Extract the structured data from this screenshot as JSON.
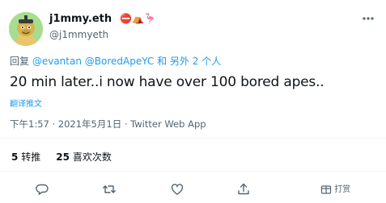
{
  "author": {
    "display_name": "j1mmy.eth",
    "badges": "⛔⛺🦩",
    "handle": "@j1mmyeth"
  },
  "tweet": {
    "reply_prefix": "回复",
    "reply_mentions": "@evantan @BoredApeYC",
    "reply_suffix": "和 另外 2 个人",
    "text": "20 min later..i now have over 100 bored apes..",
    "translate_label": "翻译推文",
    "timestamp": "下午1:57 · 2021年5月1日 · Twitter Web App"
  },
  "stats": {
    "retweets_count": "5",
    "retweets_label": "转推",
    "likes_count": "25",
    "likes_label": "喜欢次数"
  },
  "actions": {
    "tip_label": "打赏"
  },
  "colors": {
    "accent": "#1d9bf0",
    "muted": "#536471",
    "divider": "#eff3f4"
  },
  "icons": [
    "more-icon",
    "reply-icon",
    "retweet-icon",
    "like-icon",
    "share-icon",
    "tip-icon"
  ]
}
